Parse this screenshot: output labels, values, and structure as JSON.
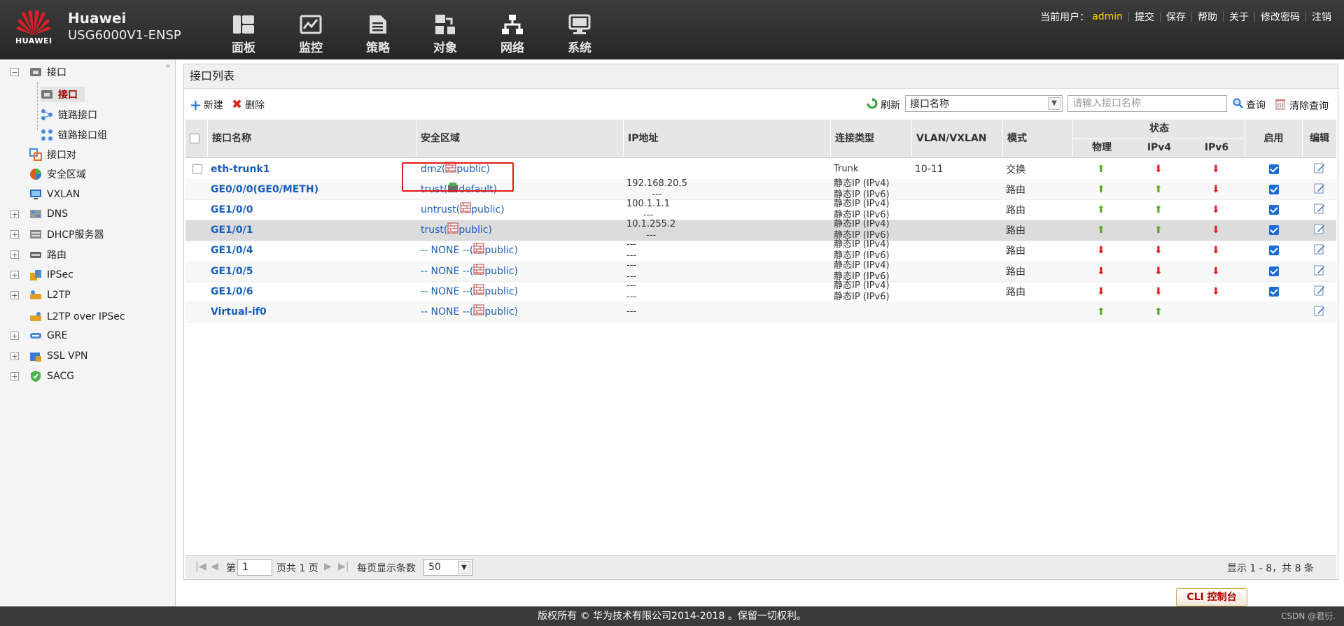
{
  "header": {
    "logo_text": "HUAWEI",
    "brand_name": "Huawei",
    "model": "USG6000V1-ENSP",
    "nav": [
      {
        "label": "面板",
        "icon": "dashboard-icon"
      },
      {
        "label": "监控",
        "icon": "monitor-icon"
      },
      {
        "label": "策略",
        "icon": "policy-icon"
      },
      {
        "label": "对象",
        "icon": "object-icon"
      },
      {
        "label": "网络",
        "icon": "network-icon"
      },
      {
        "label": "系统",
        "icon": "system-icon"
      }
    ],
    "current_user_label": "当前用户：",
    "user": "admin",
    "links": [
      "提交",
      "保存",
      "帮助",
      "关于",
      "修改密码",
      "注销"
    ]
  },
  "sidebar": {
    "items": [
      {
        "label": "接口"
      },
      {
        "label": "接口"
      },
      {
        "label": "链路接口"
      },
      {
        "label": "链路接口组"
      },
      {
        "label": "接口对"
      },
      {
        "label": "安全区域"
      },
      {
        "label": "VXLAN"
      },
      {
        "label": "DNS"
      },
      {
        "label": "DHCP服务器"
      },
      {
        "label": "路由"
      },
      {
        "label": "IPSec"
      },
      {
        "label": "L2TP"
      },
      {
        "label": "L2TP over IPSec"
      },
      {
        "label": "GRE"
      },
      {
        "label": "SSL VPN"
      },
      {
        "label": "SACG"
      }
    ]
  },
  "panel": {
    "title": "接口列表",
    "new_label": "新建",
    "delete_label": "删除",
    "refresh_label": "刷新",
    "filter_select": "接口名称",
    "search_placeholder": "请输入接口名称",
    "query_label": "查询",
    "clear_label": "清除查询"
  },
  "table": {
    "headers": {
      "name": "接口名称",
      "zone": "安全区域",
      "ip": "IP地址",
      "conn": "连接类型",
      "vlan": "VLAN/VXLAN",
      "mode": "模式",
      "status": "状态",
      "phys": "物理",
      "ipv4": "IPv4",
      "ipv6": "IPv6",
      "enable": "启用",
      "edit": "编辑"
    },
    "rows": [
      {
        "name": "eth-trunk1",
        "zone_prefix": "dmz(",
        "zone_suffix": " public)",
        "ip1": "",
        "ip2": "",
        "conn1": "Trunk",
        "conn2": "",
        "vlan": "10-11",
        "mode": "交换",
        "phys": "up",
        "ipv4": "down",
        "ipv6": "down",
        "enabled": true
      },
      {
        "name": "GE0/0/0(GE0/METH)",
        "zone_prefix": "trust(",
        "zone_suffix": " default)",
        "ip1": "192.168.20.5",
        "ip2": "---",
        "conn1": "静态IP (IPv4)",
        "conn2": "静态IP (IPv6)",
        "vlan": "",
        "mode": "路由",
        "phys": "up",
        "ipv4": "up",
        "ipv6": "down",
        "enabled": true
      },
      {
        "name": "GE1/0/0",
        "zone_prefix": "untrust(",
        "zone_suffix": " public)",
        "ip1": "100.1.1.1",
        "ip2": "---",
        "conn1": "静态IP (IPv4)",
        "conn2": "静态IP (IPv6)",
        "vlan": "",
        "mode": "路由",
        "phys": "up",
        "ipv4": "up",
        "ipv6": "down",
        "enabled": true
      },
      {
        "name": "GE1/0/1",
        "zone_prefix": "trust(",
        "zone_suffix": " public)",
        "ip1": "10.1.255.2",
        "ip2": "---",
        "conn1": "静态IP (IPv4)",
        "conn2": "静态IP (IPv6)",
        "vlan": "",
        "mode": "路由",
        "phys": "up",
        "ipv4": "up",
        "ipv6": "down",
        "enabled": true
      },
      {
        "name": "GE1/0/4",
        "zone_prefix": "-- NONE --(",
        "zone_suffix": " public)",
        "ip1": "---",
        "ip2": "---",
        "conn1": "静态IP (IPv4)",
        "conn2": "静态IP (IPv6)",
        "vlan": "",
        "mode": "路由",
        "phys": "down",
        "ipv4": "down",
        "ipv6": "down",
        "enabled": true
      },
      {
        "name": "GE1/0/5",
        "zone_prefix": "-- NONE --(",
        "zone_suffix": " public)",
        "ip1": "---",
        "ip2": "---",
        "conn1": "静态IP (IPv4)",
        "conn2": "静态IP (IPv6)",
        "vlan": "",
        "mode": "路由",
        "phys": "down",
        "ipv4": "down",
        "ipv6": "down",
        "enabled": true
      },
      {
        "name": "GE1/0/6",
        "zone_prefix": "-- NONE --(",
        "zone_suffix": " public)",
        "ip1": "---",
        "ip2": "---",
        "conn1": "静态IP (IPv4)",
        "conn2": "静态IP (IPv6)",
        "vlan": "",
        "mode": "路由",
        "phys": "down",
        "ipv4": "down",
        "ipv6": "down",
        "enabled": true
      },
      {
        "name": "Virtual-if0",
        "zone_prefix": "-- NONE --(",
        "zone_suffix": " public)",
        "ip1": "---",
        "ip2": "",
        "conn1": "",
        "conn2": "",
        "vlan": "",
        "mode": "",
        "phys": "up",
        "ipv4": "up",
        "ipv6": "",
        "enabled": null
      }
    ]
  },
  "pager": {
    "page_prefix": "第",
    "page_value": "1",
    "page_suffix": "页共 1 页",
    "per_page_label": "每页显示条数",
    "per_page_value": "50",
    "summary": "显示 1 - 8，共 8 条"
  },
  "cli_button": "CLI 控制台",
  "footer": {
    "copyright": "版权所有 © 华为技术有限公司2014-2018 。保留一切权利。",
    "watermark": "CSDN @君衍."
  },
  "colors": {
    "accent_red": "#e21a1a",
    "link_blue": "#1a5db8",
    "status_up": "#5ca82c",
    "status_down": "#e02020",
    "user_yellow": "#ffd400"
  }
}
